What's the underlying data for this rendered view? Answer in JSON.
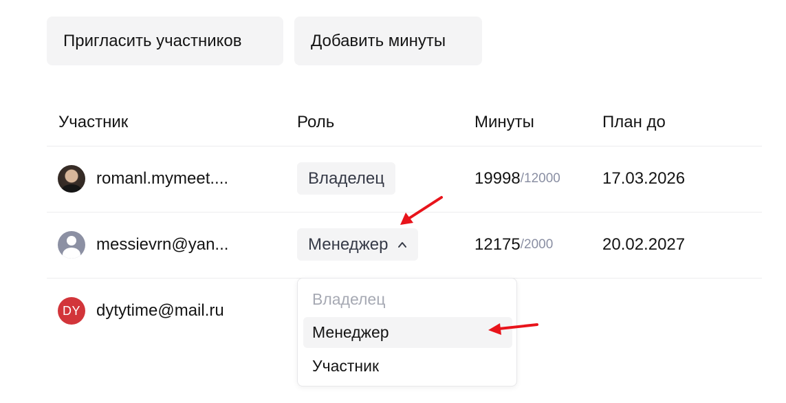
{
  "actions": {
    "invite_label": "Пригласить участников",
    "add_minutes_label": "Добавить минуты"
  },
  "table": {
    "headers": {
      "member": "Участник",
      "role": "Роль",
      "minutes": "Минуты",
      "plan_until": "План до"
    },
    "rows": [
      {
        "email": "romanl.mymeet....",
        "avatar": "photo-avatar",
        "role": "Владелец",
        "minutes_used": "19998",
        "minutes_limit": "/12000",
        "plan_until": "17.03.2026"
      },
      {
        "email": "messievrn@yan...",
        "avatar": "person-icon",
        "role": "Менеджер",
        "minutes_used": "12175",
        "minutes_limit": "/2000",
        "plan_until": "20.02.2027"
      },
      {
        "email": "dytytime@mail.ru",
        "avatar_initials": "DY",
        "role": "",
        "minutes_used": "",
        "minutes_limit": "",
        "plan_until": ""
      }
    ]
  },
  "role_dropdown": {
    "options": [
      {
        "label": "Владелец",
        "state": "disabled"
      },
      {
        "label": "Менеджер",
        "state": "selected"
      },
      {
        "label": "Участник",
        "state": "default"
      }
    ]
  },
  "colors": {
    "button_bg": "#f4f4f5",
    "muted_text": "#8a8fa3",
    "initials_avatar": "#d2353a",
    "annotation_arrow": "#e8141b"
  },
  "icons": {
    "role_select_chevron": "chevron-up-icon",
    "annotation": "red-arrow-icon"
  }
}
